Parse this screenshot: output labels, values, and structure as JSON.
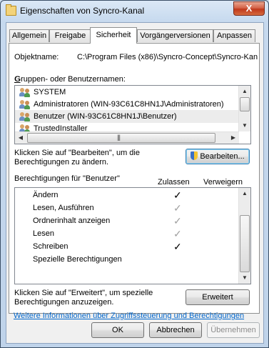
{
  "window": {
    "title": "Eigenschaften von Syncro-Kanal",
    "close_glyph": "X"
  },
  "tabs": [
    {
      "label": "Allgemein"
    },
    {
      "label": "Freigabe"
    },
    {
      "label": "Sicherheit",
      "active": true
    },
    {
      "label": "Vorgängerversionen"
    },
    {
      "label": "Anpassen"
    }
  ],
  "security": {
    "object_label": "Objektname:",
    "object_value": "C:\\Program Files (x86)\\Syncro-Concept\\Syncro-Kan",
    "groups_label": "Gruppen- oder Benutzernamen:",
    "groups": [
      {
        "name": "SYSTEM"
      },
      {
        "name": "Administratoren (WIN-93C61C8HN1J\\Administratoren)"
      },
      {
        "name": "Benutzer (WIN-93C61C8HN1J\\Benutzer)",
        "selected": true
      },
      {
        "name": "TrustedInstaller"
      }
    ],
    "edit_hint_line1": "Klicken Sie auf \"Bearbeiten\", um die",
    "edit_hint_line2": "Berechtigungen zu ändern.",
    "edit_button": "Bearbeiten...",
    "perm_label": "Berechtigungen für \"Benutzer\"",
    "col_allow": "Zulassen",
    "col_deny": "Verweigern",
    "permissions": [
      {
        "name": "Ändern",
        "allow": "✓",
        "allow_state": "checked",
        "deny": ""
      },
      {
        "name": "Lesen, Ausführen",
        "allow": "✓",
        "allow_state": "inherited",
        "deny": ""
      },
      {
        "name": "Ordnerinhalt anzeigen",
        "allow": "✓",
        "allow_state": "inherited",
        "deny": ""
      },
      {
        "name": "Lesen",
        "allow": "✓",
        "allow_state": "inherited",
        "deny": ""
      },
      {
        "name": "Schreiben",
        "allow": "✓",
        "allow_state": "checked",
        "deny": ""
      },
      {
        "name": "Spezielle Berechtigungen",
        "allow": "",
        "allow_state": "none",
        "deny": ""
      }
    ],
    "advanced_hint_line1": "Klicken Sie auf \"Erweitert\", um spezielle",
    "advanced_hint_line2": "Berechtigungen anzuzeigen.",
    "advanced_button": "Erweitert",
    "help_link": "Weitere Informationen über Zugriffssteuerung und Berechtigungen"
  },
  "footer": {
    "ok": "OK",
    "cancel": "Abbrechen",
    "apply": "Übernehmen"
  },
  "colors": {
    "link": "#0066cc",
    "check_checked": "#000000",
    "check_inherited": "#a0a0a0"
  }
}
